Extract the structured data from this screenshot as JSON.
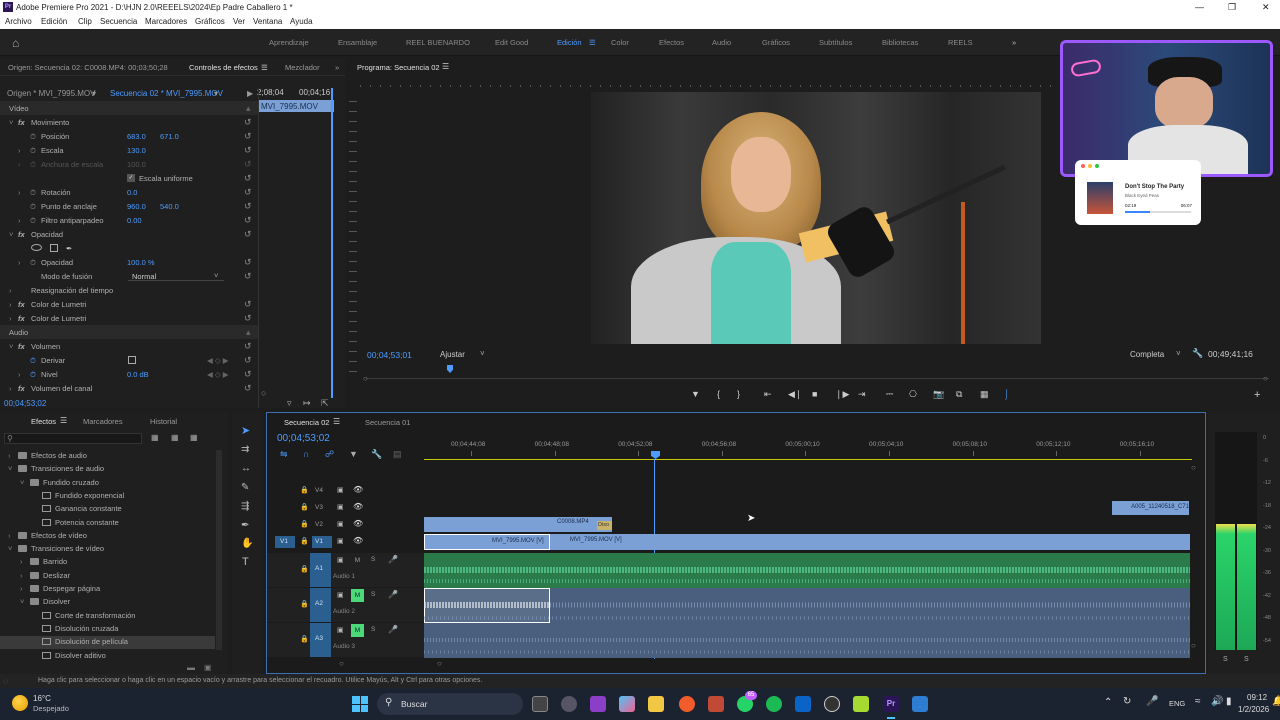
{
  "titlebar": {
    "title": "Adobe Premiere Pro 2021 - D:\\HJN 2.0\\REEELS\\2024\\Ep Padre Caballero 1 *",
    "logo": "Pr"
  },
  "menu": [
    "Archivo",
    "Edición",
    "Clip",
    "Secuencia",
    "Marcadores",
    "Gráficos",
    "Ver",
    "Ventana",
    "Ayuda"
  ],
  "workspaces": [
    "Aprendizaje",
    "Ensamblaje",
    "REEL BUENARDO",
    "Edit Good",
    "Edición",
    "Color",
    "Efectos",
    "Audio",
    "Gráficos",
    "Subtítulos",
    "Bibliotecas",
    "REELS"
  ],
  "active_workspace": "Edición",
  "effect_controls": {
    "source_tab": "Origen: Secuencia 02: C0008.MP4: 00;03;50;28",
    "tab": "Controles de efectos",
    "mixer_tab": "Mezclador",
    "master": "Origen * MVI_7995.MOV",
    "sequence": "Secuencia 02 * MVI_7995.MOV",
    "mini_tc1": "2;08;04",
    "mini_tc2": "00;04;16",
    "clip_name": "MVI_7995.MOV",
    "video_header": "Vídeo",
    "motion": "Movimiento",
    "position_label": "Posición",
    "position_x": "683.0",
    "position_y": "671.0",
    "scale_label": "Escala",
    "scale_val": "130.0",
    "scale_width_label": "Anchura de escala",
    "scale_width_val": "100.0",
    "uniform_label": "Escala uniforme",
    "rotation_label": "Rotación",
    "rotation_val": "0.0",
    "anchor_label": "Punto de anclaje",
    "anchor_x": "960.0",
    "anchor_y": "540.0",
    "flicker_label": "Filtro antiparpadeo",
    "flicker_val": "0.00",
    "opacity_header": "Opacidad",
    "opacity_label": "Opacidad",
    "opacity_val": "100.0 %",
    "blend_label": "Modo de fusión",
    "blend_val": "Normal",
    "time_remap": "Reasignación del tiempo",
    "lumetri1": "Color de Lumetri",
    "lumetri2": "Color de Lumetri",
    "audio_header": "Audio",
    "volume": "Volumen",
    "bypass_label": "Derivar",
    "level_label": "Nivel",
    "level_val": "0.0 dB",
    "channel_volume": "Volumen del canal",
    "timecode": "00;04;53;02"
  },
  "program": {
    "tab": "Programa: Secuencia 02",
    "timecode": "00;04;53;01",
    "fit": "Ajustar",
    "quality": "Completa",
    "duration": "00;49;41;16"
  },
  "webcam_overlay": {
    "song": "Don't Stop The Party",
    "artist": "Black Eyed Peas",
    "elapsed": "02:19",
    "total": "06:07"
  },
  "effects_panel": {
    "tabs": [
      "Efectos",
      "Marcadores",
      "Historial"
    ],
    "tree": [
      {
        "label": "Efectos de audio",
        "level": 0,
        "open": false,
        "folder": true
      },
      {
        "label": "Transiciones de audio",
        "level": 0,
        "open": true,
        "folder": true
      },
      {
        "label": "Fundido cruzado",
        "level": 1,
        "open": true,
        "folder": true
      },
      {
        "label": "Fundido exponencial",
        "level": 2,
        "folder": false
      },
      {
        "label": "Ganancia constante",
        "level": 2,
        "folder": false
      },
      {
        "label": "Potencia constante",
        "level": 2,
        "folder": false
      },
      {
        "label": "Efectos de vídeo",
        "level": 0,
        "open": false,
        "folder": true
      },
      {
        "label": "Transiciones de vídeo",
        "level": 0,
        "open": true,
        "folder": true
      },
      {
        "label": "Barrido",
        "level": 1,
        "open": false,
        "folder": true
      },
      {
        "label": "Deslizar",
        "level": 1,
        "open": false,
        "folder": true
      },
      {
        "label": "Despegar página",
        "level": 1,
        "open": false,
        "folder": true
      },
      {
        "label": "Disolver",
        "level": 1,
        "open": true,
        "folder": true
      },
      {
        "label": "Corte de transformación",
        "level": 2,
        "folder": false
      },
      {
        "label": "Disolución cruzada",
        "level": 2,
        "folder": false
      },
      {
        "label": "Disolución de película",
        "level": 2,
        "folder": false,
        "selected": true
      },
      {
        "label": "Disolver aditivo",
        "level": 2,
        "folder": false
      }
    ]
  },
  "timeline": {
    "tabs": [
      "Secuencia 02",
      "Secuencia 01"
    ],
    "timecode": "00;04;53;02",
    "ruler": [
      "00;04;44;08",
      "00;04;48;08",
      "00;04;52;08",
      "00;04;56;08",
      "00;05;00;10",
      "00;05;04;10",
      "00;05;08;10",
      "00;05;12;10",
      "00;05;16;10"
    ],
    "video_tracks": [
      "V4",
      "V3",
      "V2",
      "V1"
    ],
    "audio_tracks": [
      {
        "id": "A1",
        "name": "Audio 1"
      },
      {
        "id": "A2",
        "name": "Audio 2"
      },
      {
        "id": "A3",
        "name": "Audio 3"
      }
    ],
    "clips": {
      "v2": "C0008.MP4",
      "v2b": "Diso",
      "v1a": "MVI_7995.MOV [V]",
      "v1b": "MVI_7995.MOV [V]",
      "v4": "A005_11240518_C71"
    },
    "source_patch": "V1",
    "m": "M",
    "s": "S"
  },
  "meter_scale": [
    "0",
    "-6",
    "-12",
    "-18",
    "-24",
    "-30",
    "-36",
    "-42",
    "-48",
    "-54"
  ],
  "meter_s": [
    "S",
    "S"
  ],
  "status": "Haga clic para seleccionar o haga clic en un espacio vacío y arrastre para seleccionar el recuadro. Utilice Mayús, Alt y Ctrl para otras opciones.",
  "taskbar": {
    "temp": "16°C",
    "weather": "Despejado",
    "search": "Buscar",
    "lang": "ENG",
    "time": "09:12",
    "date": "1/2/2026",
    "badge": "65"
  }
}
